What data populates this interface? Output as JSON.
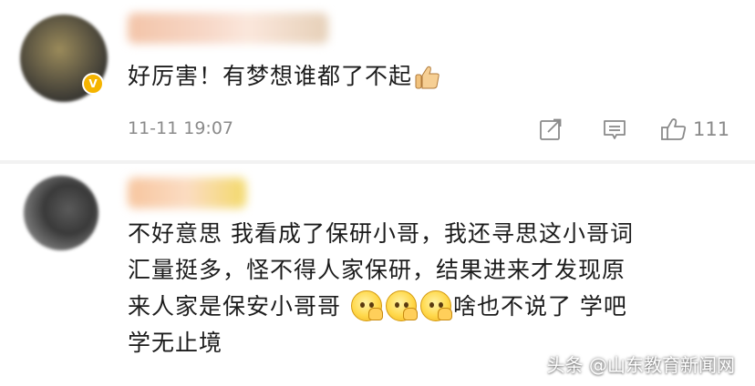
{
  "comments": [
    {
      "text": "好厉害！有梦想谁都了不起",
      "trailing_emoji": "thumbs-up",
      "timestamp": "11-11 19:07",
      "likes": "111",
      "badge": "V"
    },
    {
      "lines": [
        "不好意思 我看成了保研小哥，我还寻思这小哥词",
        "汇量挺多，怪不得人家保研，结果进来才发现原",
        "来人家是保安小哥哥",
        "啥也不说了 学吧",
        "学无止境"
      ],
      "inline_emoji": [
        "smug-emoji",
        "smug-emoji",
        "smug-emoji"
      ]
    }
  ],
  "watermark": "头条 @山东教育新闻网",
  "icons": {
    "share": "share-icon",
    "comment": "comment-icon",
    "like": "thumbs-up-icon"
  },
  "colors": {
    "text": "#1c1c1c",
    "meta": "#8a8a8a",
    "divider": "#f2f2f2",
    "vip_badge": "#f5b400"
  }
}
